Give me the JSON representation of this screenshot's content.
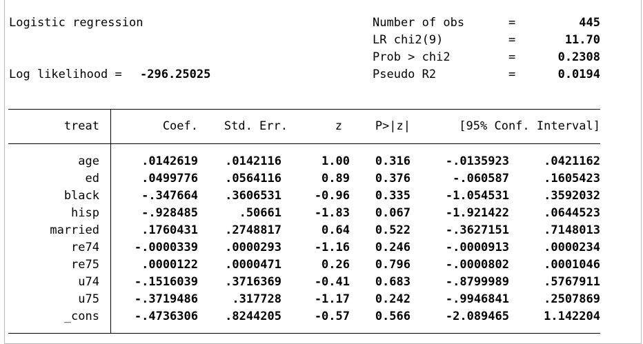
{
  "header": {
    "title": "Logistic regression",
    "log_likelihood_label": "Log likelihood =",
    "log_likelihood_value": "-296.25025",
    "stats": [
      {
        "label": "Number of obs",
        "eq": "=",
        "value": "445"
      },
      {
        "label": "LR chi2(9)",
        "eq": "=",
        "value": "11.70"
      },
      {
        "label": "Prob > chi2",
        "eq": "=",
        "value": "0.2308"
      },
      {
        "label": "Pseudo R2",
        "eq": "=",
        "value": "0.0194"
      }
    ]
  },
  "table": {
    "depvar": "treat",
    "columns": [
      "Coef.",
      "Std. Err.",
      "z",
      "P>|z|",
      "[95% Conf. Interval]"
    ],
    "rows": [
      {
        "var": "age",
        "coef": ".0142619",
        "se": ".0142116",
        "z": "1.00",
        "p": "0.316",
        "lo": "-.0135923",
        "hi": ".0421162"
      },
      {
        "var": "ed",
        "coef": ".0499776",
        "se": ".0564116",
        "z": "0.89",
        "p": "0.376",
        "lo": "-.060587",
        "hi": ".1605423"
      },
      {
        "var": "black",
        "coef": "-.347664",
        "se": ".3606531",
        "z": "-0.96",
        "p": "0.335",
        "lo": "-1.054531",
        "hi": ".3592032"
      },
      {
        "var": "hisp",
        "coef": "-.928485",
        "se": ".50661",
        "z": "-1.83",
        "p": "0.067",
        "lo": "-1.921422",
        "hi": ".0644523"
      },
      {
        "var": "married",
        "coef": ".1760431",
        "se": ".2748817",
        "z": "0.64",
        "p": "0.522",
        "lo": "-.3627151",
        "hi": ".7148013"
      },
      {
        "var": "re74",
        "coef": "-.0000339",
        "se": ".0000293",
        "z": "-1.16",
        "p": "0.246",
        "lo": "-.0000913",
        "hi": ".0000234"
      },
      {
        "var": "re75",
        "coef": ".0000122",
        "se": ".0000471",
        "z": "0.26",
        "p": "0.796",
        "lo": "-.0000802",
        "hi": ".0001046"
      },
      {
        "var": "u74",
        "coef": "-.1516039",
        "se": ".3716369",
        "z": "-0.41",
        "p": "0.683",
        "lo": "-.8799989",
        "hi": ".5767911"
      },
      {
        "var": "u75",
        "coef": "-.3719486",
        "se": ".317728",
        "z": "-1.17",
        "p": "0.242",
        "lo": "-.9946841",
        "hi": ".2507869"
      },
      {
        "var": "_cons",
        "coef": "-.4736306",
        "se": ".8244205",
        "z": "-0.57",
        "p": "0.566",
        "lo": "-2.089465",
        "hi": "1.142204"
      }
    ]
  }
}
